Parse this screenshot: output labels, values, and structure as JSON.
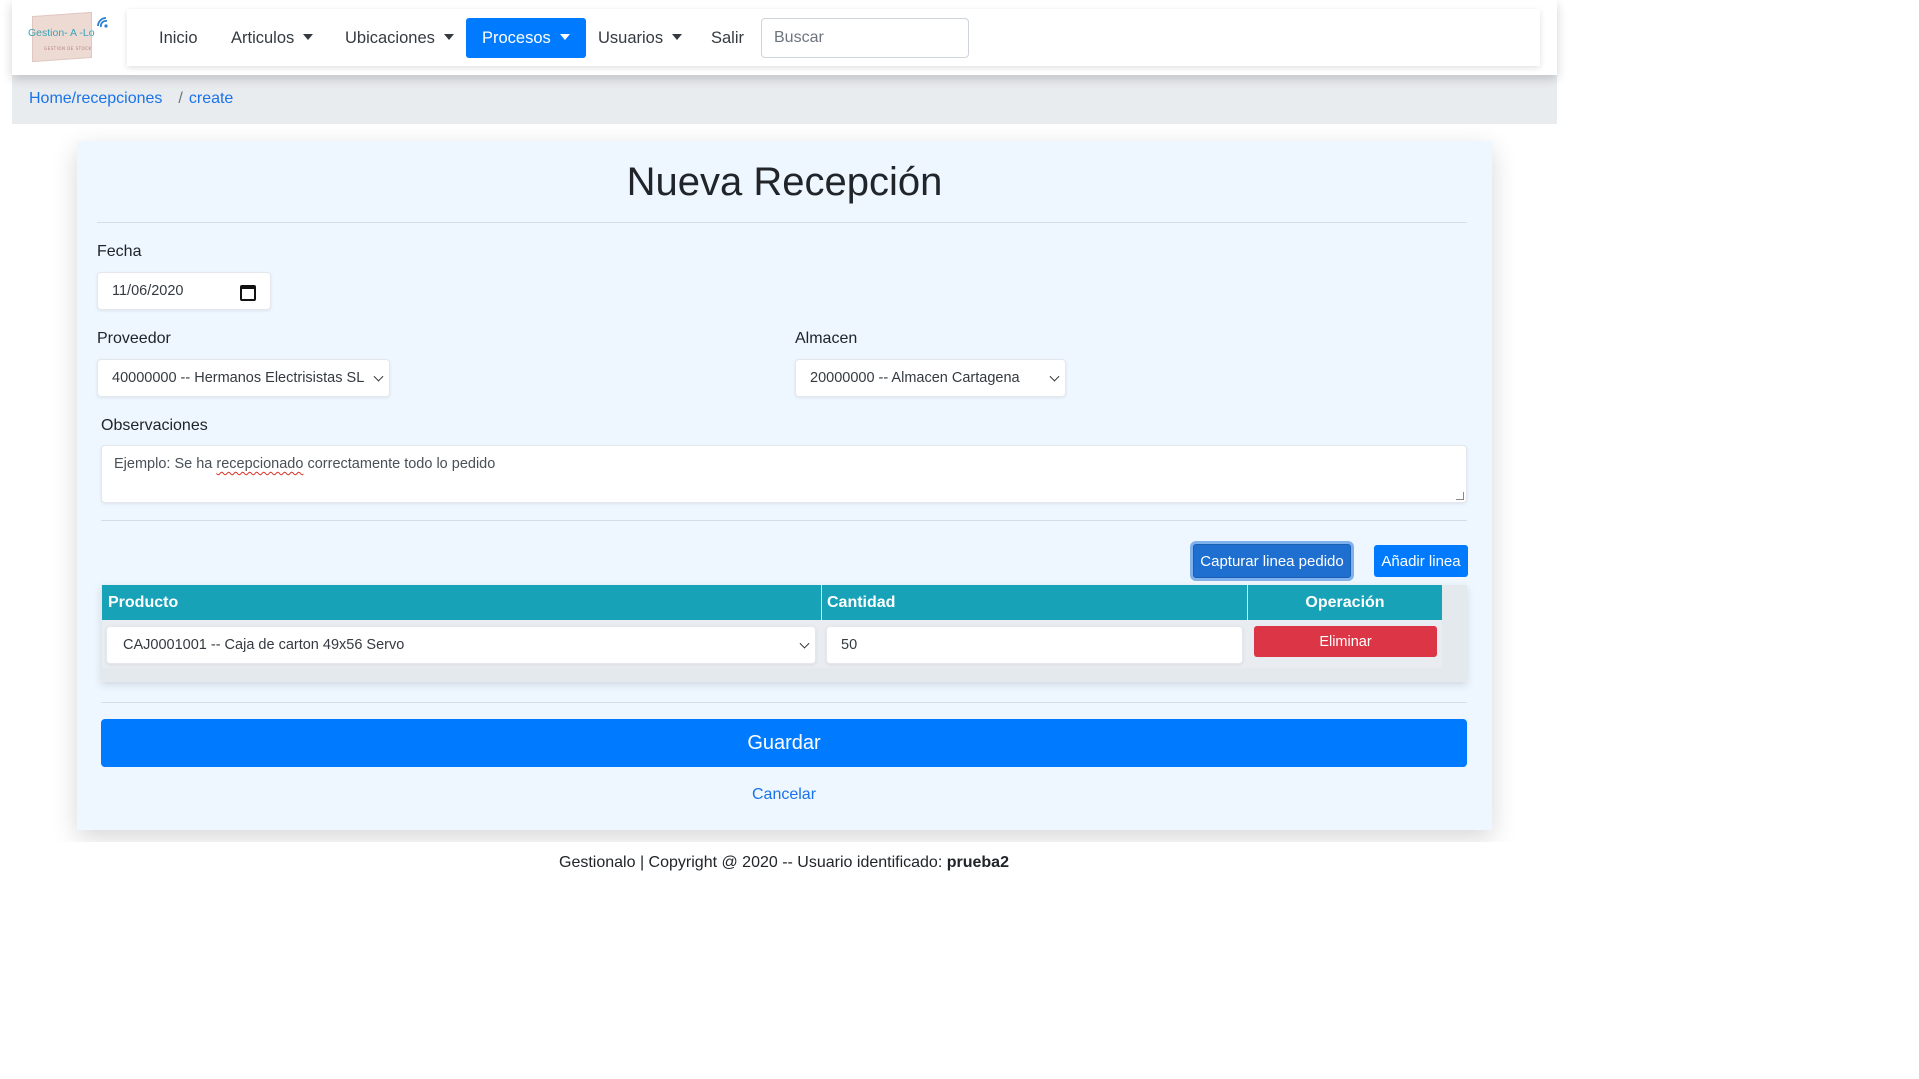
{
  "brand": {
    "logo_text": "Gestion- A -Lo",
    "logo_subtext": "GESTION DE STOCK"
  },
  "nav": {
    "items": [
      {
        "label": "Inicio",
        "dropdown": false
      },
      {
        "label": "Articulos",
        "dropdown": true
      },
      {
        "label": "Ubicaciones",
        "dropdown": true
      },
      {
        "label": "Procesos",
        "dropdown": true,
        "active": true
      },
      {
        "label": "Usuarios",
        "dropdown": true
      },
      {
        "label": "Salir",
        "dropdown": false
      }
    ],
    "search_placeholder": "Buscar"
  },
  "breadcrumb": {
    "home": "Home/recepciones",
    "separator": "/",
    "current": "create"
  },
  "form": {
    "title": "Nueva Recepción",
    "fecha_label": "Fecha",
    "fecha_value": "11/06/2020",
    "proveedor_label": "Proveedor",
    "proveedor_value": "40000000 -- Hermanos Electrisistas SL",
    "almacen_label": "Almacen",
    "almacen_value": "20000000 -- Almacen Cartagena",
    "observaciones_label": "Observaciones",
    "observaciones_pre": "Ejemplo: Se ha ",
    "observaciones_misspelled": "recepcionado",
    "observaciones_post": " correctamente todo lo pedido",
    "capture_button": "Capturar linea pedido",
    "add_line_button": "Añadir linea",
    "save_button": "Guardar",
    "cancel_link": "Cancelar"
  },
  "table": {
    "headers": [
      "Producto",
      "Cantidad",
      "Operación"
    ],
    "rows": [
      {
        "producto": "CAJ0001001 -- Caja de carton 49x56 Servo",
        "cantidad": "50",
        "operacion": "Eliminar"
      }
    ]
  },
  "footer": {
    "text": "Gestionalo | Copyright @ 2020 -- Usuario identificado: ",
    "user": "prueba2"
  },
  "colors": {
    "primary": "#007bff",
    "table_header": "#17a2b8",
    "danger": "#dc3545",
    "card_bg": "#eef6ff"
  }
}
